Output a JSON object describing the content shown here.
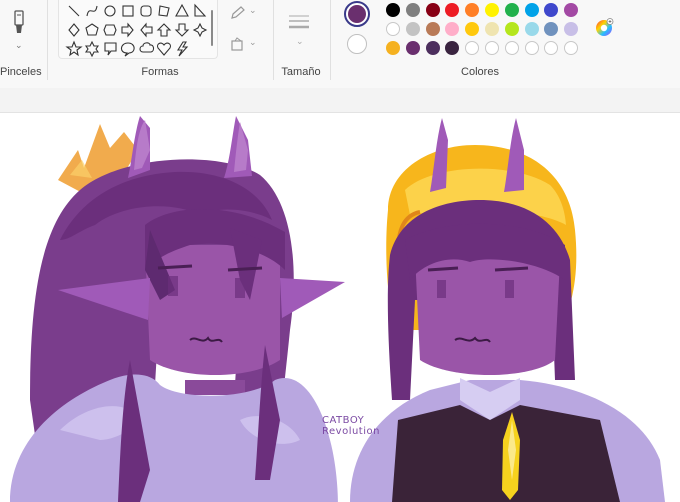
{
  "ribbon": {
    "brushes": {
      "label": "Pinceles"
    },
    "shapes": {
      "label": "Formas",
      "icons": [
        "line-shape",
        "curve-shape",
        "oval-shape",
        "rectangle-shape",
        "rounded-rectangle-shape",
        "polygon-shape",
        "triangle-shape",
        "right-triangle-shape",
        "diamond-shape",
        "pentagon-shape",
        "hexagon-shape",
        "right-arrow-shape",
        "left-arrow-shape",
        "up-arrow-shape",
        "down-arrow-shape",
        "four-point-star-shape",
        "five-point-star-shape",
        "six-point-star-shape",
        "rectangle-callout-shape",
        "oval-callout-shape",
        "cloud-callout-shape",
        "heart-shape",
        "lightning-shape"
      ]
    },
    "size": {
      "label": "Tamaño"
    },
    "colors": {
      "label": "Colores",
      "primary": "#6a2f6e",
      "secondary": "#ffffff",
      "row1": [
        "#000000",
        "#7f7f7f",
        "#880015",
        "#ed1c24",
        "#ff7f27",
        "#fff200",
        "#22b14c",
        "#00a2e8",
        "#3f48cc",
        "#a349a4"
      ],
      "row2": [
        "#ffffff",
        "#c3c3c3",
        "#b97a57",
        "#ffaec9",
        "#ffc90e",
        "#efe4b0",
        "#b5e61d",
        "#99d9ea",
        "#7092be",
        "#c8bfe7"
      ],
      "row3": [
        "#f5b120",
        "#6a2f6e",
        "#4d2f5e",
        "#3a2440",
        "",
        "",
        "",
        "",
        "",
        ""
      ]
    }
  },
  "canvas": {
    "signature_line1": "CATBOY",
    "signature_line2": "Revolution"
  }
}
